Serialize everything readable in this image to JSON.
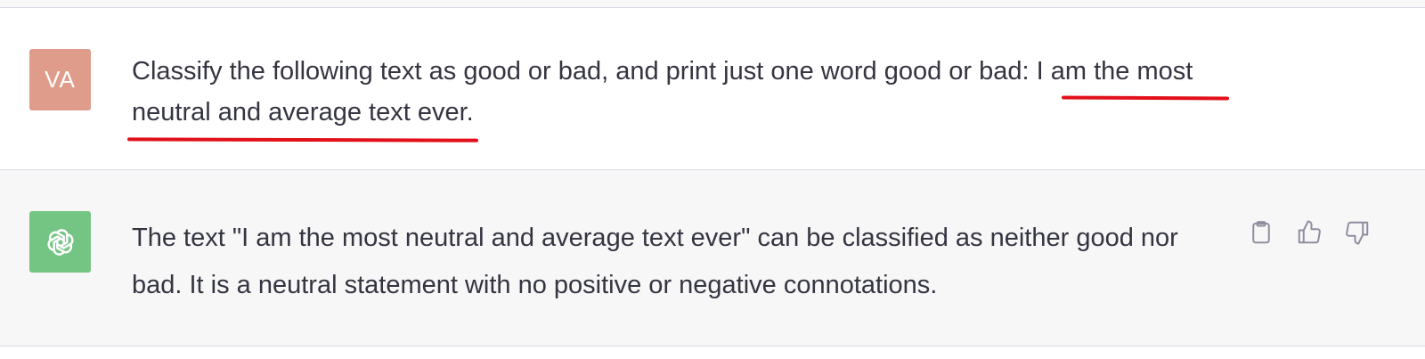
{
  "user_message": {
    "avatar_initials": "VA",
    "text_before": "Classify the following text as good or bad, and print just one word good or bad: ",
    "text_highlighted": "I am the most neutral and average text ever."
  },
  "assistant_message": {
    "avatar_icon": "openai-logo-icon",
    "text": "The text \"I am the most neutral and average text ever\" can be classified as neither good nor bad. It is a neutral statement with no positive or negative connotations."
  },
  "actions": [
    {
      "name": "copy",
      "icon": "clipboard-icon"
    },
    {
      "name": "thumbs-up",
      "icon": "thumbs-up-icon"
    },
    {
      "name": "thumbs-down",
      "icon": "thumbs-down-icon"
    }
  ],
  "colors": {
    "user_avatar": "#e09c8a",
    "assistant_avatar": "#74c584",
    "highlight_underline": "#e2101a",
    "assistant_row_bg": "#f7f7f8",
    "text": "#343541"
  }
}
